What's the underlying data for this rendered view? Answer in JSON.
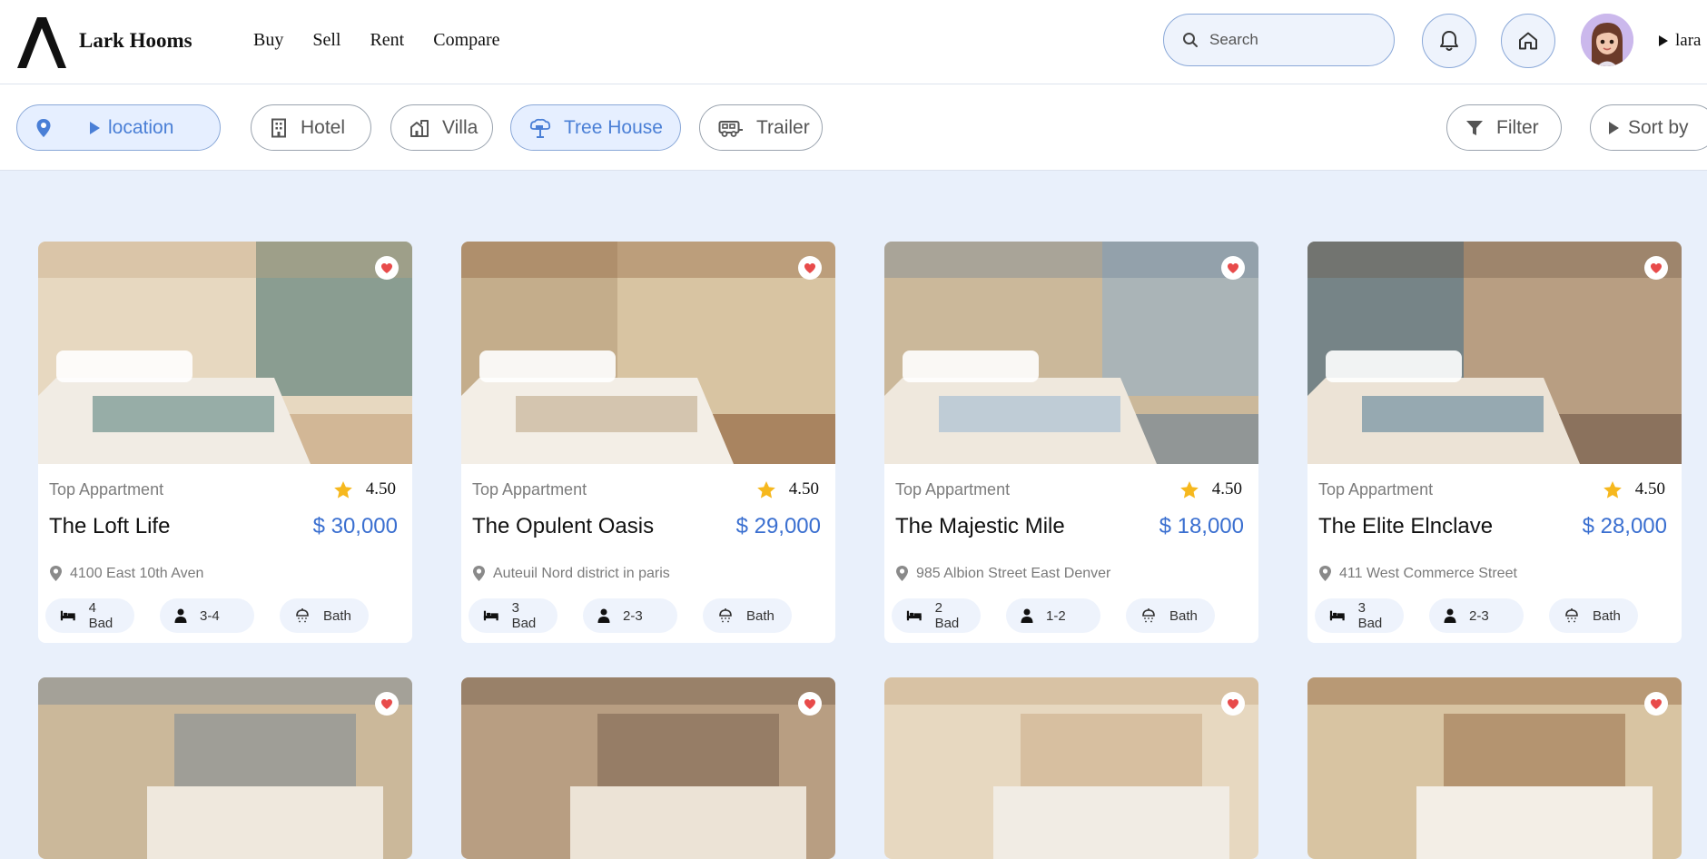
{
  "brand": {
    "name": "Lark Hooms"
  },
  "nav": [
    "Buy",
    "Sell",
    "Rent",
    "Compare"
  ],
  "search": {
    "placeholder": "Search"
  },
  "user": {
    "name": "lara"
  },
  "filters": {
    "location": "location",
    "types": [
      "Hotel",
      "Villa",
      "Tree House",
      "Trailer"
    ],
    "active_type": "Tree House",
    "filter_label": "Filter",
    "sort_label": "Sort by"
  },
  "colors": {
    "accent": "#3a6fd0",
    "page_bg": "#e9f0fb",
    "star": "#f6b81e",
    "heart": "#e84b4b"
  },
  "listings": [
    {
      "category": "Top Appartment",
      "rating": "4.50",
      "name": "The Loft Life",
      "price": "$ 30,000",
      "address": "4100 East 10th Aven",
      "beds": "4 Bad",
      "guests": "3-4",
      "bath": "Bath"
    },
    {
      "category": "Top Appartment",
      "rating": "4.50",
      "name": "The Opulent Oasis",
      "price": "$ 29,000",
      "address": "Auteuil Nord district in paris",
      "beds": "3 Bad",
      "guests": "2-3",
      "bath": "Bath"
    },
    {
      "category": "Top Appartment",
      "rating": "4.50",
      "name": "The Majestic Mile",
      "price": "$ 18,000",
      "address": "985 Albion Street East Denver",
      "beds": "2 Bad",
      "guests": "1-2",
      "bath": "Bath"
    },
    {
      "category": "Top Appartment",
      "rating": "4.50",
      "name": "The Elite Elnclave",
      "price": "$ 28,000",
      "address": "411 West Commerce Street",
      "beds": "3 Bad",
      "guests": "2-3",
      "bath": "Bath"
    }
  ]
}
